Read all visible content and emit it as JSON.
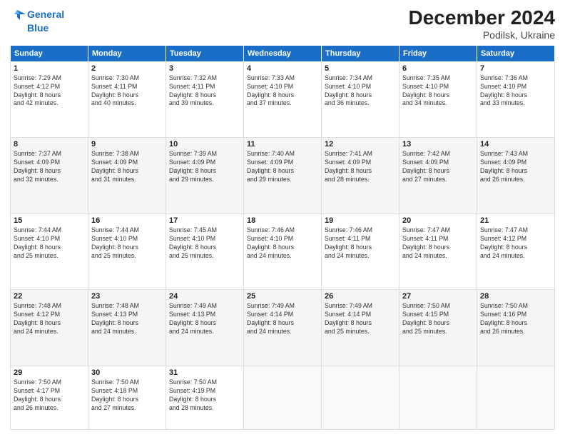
{
  "header": {
    "logo_line1": "General",
    "logo_line2": "Blue",
    "title": "December 2024",
    "subtitle": "Podilsk, Ukraine"
  },
  "weekdays": [
    "Sunday",
    "Monday",
    "Tuesday",
    "Wednesday",
    "Thursday",
    "Friday",
    "Saturday"
  ],
  "weeks": [
    [
      {
        "day": "1",
        "lines": [
          "Sunrise: 7:29 AM",
          "Sunset: 4:12 PM",
          "Daylight: 8 hours",
          "and 42 minutes."
        ]
      },
      {
        "day": "2",
        "lines": [
          "Sunrise: 7:30 AM",
          "Sunset: 4:11 PM",
          "Daylight: 8 hours",
          "and 40 minutes."
        ]
      },
      {
        "day": "3",
        "lines": [
          "Sunrise: 7:32 AM",
          "Sunset: 4:11 PM",
          "Daylight: 8 hours",
          "and 39 minutes."
        ]
      },
      {
        "day": "4",
        "lines": [
          "Sunrise: 7:33 AM",
          "Sunset: 4:10 PM",
          "Daylight: 8 hours",
          "and 37 minutes."
        ]
      },
      {
        "day": "5",
        "lines": [
          "Sunrise: 7:34 AM",
          "Sunset: 4:10 PM",
          "Daylight: 8 hours",
          "and 36 minutes."
        ]
      },
      {
        "day": "6",
        "lines": [
          "Sunrise: 7:35 AM",
          "Sunset: 4:10 PM",
          "Daylight: 8 hours",
          "and 34 minutes."
        ]
      },
      {
        "day": "7",
        "lines": [
          "Sunrise: 7:36 AM",
          "Sunset: 4:10 PM",
          "Daylight: 8 hours",
          "and 33 minutes."
        ]
      }
    ],
    [
      {
        "day": "8",
        "lines": [
          "Sunrise: 7:37 AM",
          "Sunset: 4:09 PM",
          "Daylight: 8 hours",
          "and 32 minutes."
        ]
      },
      {
        "day": "9",
        "lines": [
          "Sunrise: 7:38 AM",
          "Sunset: 4:09 PM",
          "Daylight: 8 hours",
          "and 31 minutes."
        ]
      },
      {
        "day": "10",
        "lines": [
          "Sunrise: 7:39 AM",
          "Sunset: 4:09 PM",
          "Daylight: 8 hours",
          "and 29 minutes."
        ]
      },
      {
        "day": "11",
        "lines": [
          "Sunrise: 7:40 AM",
          "Sunset: 4:09 PM",
          "Daylight: 8 hours",
          "and 29 minutes."
        ]
      },
      {
        "day": "12",
        "lines": [
          "Sunrise: 7:41 AM",
          "Sunset: 4:09 PM",
          "Daylight: 8 hours",
          "and 28 minutes."
        ]
      },
      {
        "day": "13",
        "lines": [
          "Sunrise: 7:42 AM",
          "Sunset: 4:09 PM",
          "Daylight: 8 hours",
          "and 27 minutes."
        ]
      },
      {
        "day": "14",
        "lines": [
          "Sunrise: 7:43 AM",
          "Sunset: 4:09 PM",
          "Daylight: 8 hours",
          "and 26 minutes."
        ]
      }
    ],
    [
      {
        "day": "15",
        "lines": [
          "Sunrise: 7:44 AM",
          "Sunset: 4:10 PM",
          "Daylight: 8 hours",
          "and 25 minutes."
        ]
      },
      {
        "day": "16",
        "lines": [
          "Sunrise: 7:44 AM",
          "Sunset: 4:10 PM",
          "Daylight: 8 hours",
          "and 25 minutes."
        ]
      },
      {
        "day": "17",
        "lines": [
          "Sunrise: 7:45 AM",
          "Sunset: 4:10 PM",
          "Daylight: 8 hours",
          "and 25 minutes."
        ]
      },
      {
        "day": "18",
        "lines": [
          "Sunrise: 7:46 AM",
          "Sunset: 4:10 PM",
          "Daylight: 8 hours",
          "and 24 minutes."
        ]
      },
      {
        "day": "19",
        "lines": [
          "Sunrise: 7:46 AM",
          "Sunset: 4:11 PM",
          "Daylight: 8 hours",
          "and 24 minutes."
        ]
      },
      {
        "day": "20",
        "lines": [
          "Sunrise: 7:47 AM",
          "Sunset: 4:11 PM",
          "Daylight: 8 hours",
          "and 24 minutes."
        ]
      },
      {
        "day": "21",
        "lines": [
          "Sunrise: 7:47 AM",
          "Sunset: 4:12 PM",
          "Daylight: 8 hours",
          "and 24 minutes."
        ]
      }
    ],
    [
      {
        "day": "22",
        "lines": [
          "Sunrise: 7:48 AM",
          "Sunset: 4:12 PM",
          "Daylight: 8 hours",
          "and 24 minutes."
        ]
      },
      {
        "day": "23",
        "lines": [
          "Sunrise: 7:48 AM",
          "Sunset: 4:13 PM",
          "Daylight: 8 hours",
          "and 24 minutes."
        ]
      },
      {
        "day": "24",
        "lines": [
          "Sunrise: 7:49 AM",
          "Sunset: 4:13 PM",
          "Daylight: 8 hours",
          "and 24 minutes."
        ]
      },
      {
        "day": "25",
        "lines": [
          "Sunrise: 7:49 AM",
          "Sunset: 4:14 PM",
          "Daylight: 8 hours",
          "and 24 minutes."
        ]
      },
      {
        "day": "26",
        "lines": [
          "Sunrise: 7:49 AM",
          "Sunset: 4:14 PM",
          "Daylight: 8 hours",
          "and 25 minutes."
        ]
      },
      {
        "day": "27",
        "lines": [
          "Sunrise: 7:50 AM",
          "Sunset: 4:15 PM",
          "Daylight: 8 hours",
          "and 25 minutes."
        ]
      },
      {
        "day": "28",
        "lines": [
          "Sunrise: 7:50 AM",
          "Sunset: 4:16 PM",
          "Daylight: 8 hours",
          "and 26 minutes."
        ]
      }
    ],
    [
      {
        "day": "29",
        "lines": [
          "Sunrise: 7:50 AM",
          "Sunset: 4:17 PM",
          "Daylight: 8 hours",
          "and 26 minutes."
        ]
      },
      {
        "day": "30",
        "lines": [
          "Sunrise: 7:50 AM",
          "Sunset: 4:18 PM",
          "Daylight: 8 hours",
          "and 27 minutes."
        ]
      },
      {
        "day": "31",
        "lines": [
          "Sunrise: 7:50 AM",
          "Sunset: 4:19 PM",
          "Daylight: 8 hours",
          "and 28 minutes."
        ]
      },
      {
        "day": "",
        "lines": []
      },
      {
        "day": "",
        "lines": []
      },
      {
        "day": "",
        "lines": []
      },
      {
        "day": "",
        "lines": []
      }
    ]
  ]
}
